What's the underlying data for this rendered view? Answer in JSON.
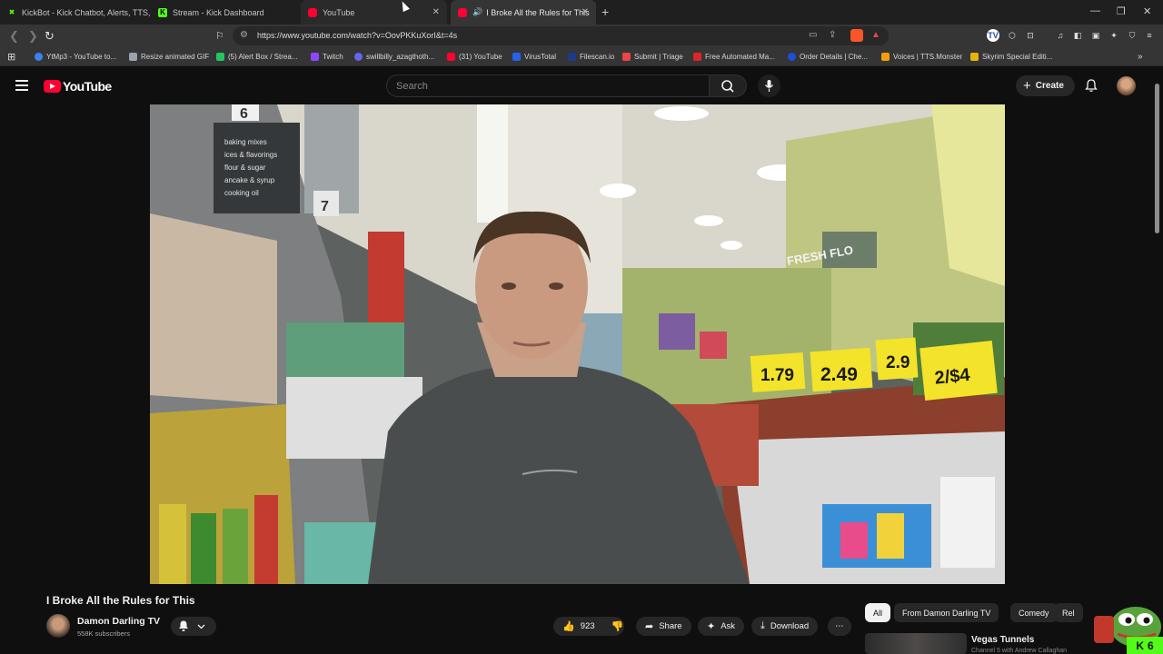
{
  "browser": {
    "tabs": [
      {
        "title": "KickBot - Kick Chatbot, Alerts, TTS, O",
        "icon": "kickbot-icon",
        "active": false
      },
      {
        "title": "Stream - Kick Dashboard",
        "icon": "kick-icon",
        "active": false
      },
      {
        "title": "YouTube",
        "icon": "youtube-icon",
        "active": false
      },
      {
        "title": "I Broke All the Rules for This",
        "icon": "youtube-icon",
        "active": true
      }
    ],
    "url": "https://www.youtube.com/watch?v=OovPKKuXorI&t=4s",
    "bookmarks": [
      {
        "label": "YtMp3 - YouTube to...",
        "color": "#3b82f6"
      },
      {
        "label": "Resize animated GIF",
        "color": "#9ca3af"
      },
      {
        "label": "(5) Alert Box / Strea...",
        "color": "#22c55e"
      },
      {
        "label": "Twitch",
        "color": "#9146ff"
      },
      {
        "label": "swillbilly_azagthoth...",
        "color": "#6366f1"
      },
      {
        "label": "(31) YouTube",
        "color": "#ff0033"
      },
      {
        "label": "VirusTotal",
        "color": "#2563eb"
      },
      {
        "label": "Filescan.io",
        "color": "#1e3a8a"
      },
      {
        "label": "Submit | Triage",
        "color": "#ef4444"
      },
      {
        "label": "Free Automated Ma...",
        "color": "#dc2626"
      },
      {
        "label": "Order Details | Che...",
        "color": "#1d4ed8"
      },
      {
        "label": "Voices | TTS.Monster",
        "color": "#f59e0b"
      },
      {
        "label": "Skyrim Special Editi...",
        "color": "#eab308"
      }
    ]
  },
  "youtube": {
    "logo_text": "YouTube",
    "search_placeholder": "Search",
    "create_label": "Create",
    "video": {
      "title": "I Broke All the Rules for This",
      "price_tags": [
        "1.79",
        "2.49",
        "2.9",
        "2/$4"
      ],
      "aisle_number": "6",
      "aisle_number_2": "7",
      "aisle_sign": [
        "baking mixes",
        "ices & flavorings",
        "flour & sugar",
        "ancake & syrup",
        "cooking oil"
      ],
      "store_sign": "FRESH FLO"
    },
    "channel": {
      "name": "Damon Darling TV",
      "subscribers": "558K subscribers"
    },
    "actions": {
      "likes": "923",
      "share": "Share",
      "ask": "Ask",
      "download": "Download"
    },
    "chips": [
      "All",
      "From Damon Darling TV",
      "Comedy",
      "Rel"
    ],
    "recommendation": {
      "title": "Vegas Tunnels",
      "subtitle": "Channel 5 with Andrew Callaghan"
    },
    "overlay_badge": "6"
  }
}
